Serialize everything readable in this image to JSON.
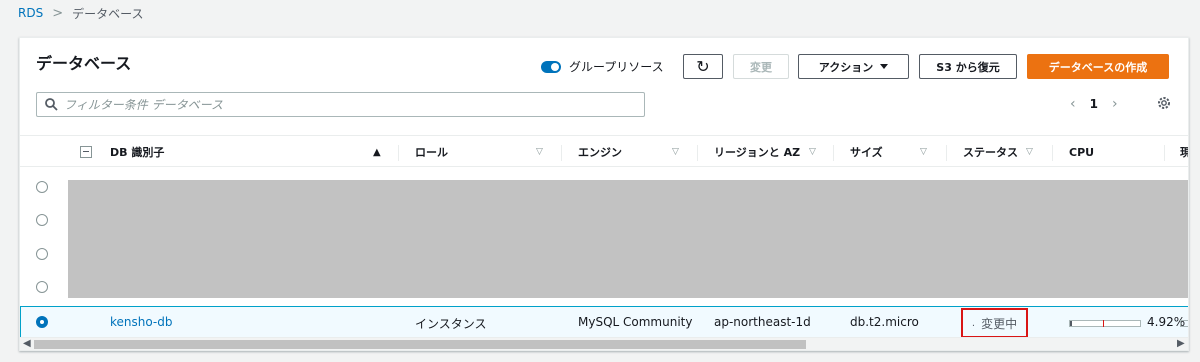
{
  "breadcrumb": {
    "root": "RDS",
    "separator": ">",
    "current": "データベース"
  },
  "panel": {
    "title": "データベース",
    "toggle_label": "グループリソース",
    "buttons": {
      "refresh": "↻",
      "modify": "変更",
      "actions": "アクション",
      "restore": "S3 から復元",
      "create": "データベースの作成"
    },
    "search": {
      "placeholder": "フィルター条件 データベース"
    },
    "pagination": {
      "prev": "‹",
      "page": "1",
      "next": "›"
    }
  },
  "table": {
    "columns": {
      "db_id": "DB 識別子",
      "role": "ロール",
      "engine": "エンジン",
      "region": "リージョンと AZ",
      "size": "サイズ",
      "status": "ステータス",
      "cpu": "CPU",
      "overflow": "現"
    },
    "selected_row": {
      "db_id": "kensho-db",
      "role": "インスタンス",
      "engine": "MySQL Community",
      "region": "ap-northeast-1d",
      "size": "db.t2.micro",
      "status": "変更中",
      "cpu": "4.92%",
      "cpu_fraction": 0.0492
    }
  },
  "colors": {
    "accent": "#0073bb",
    "primary_button": "#ec7211",
    "highlight_border": "#d91515"
  }
}
